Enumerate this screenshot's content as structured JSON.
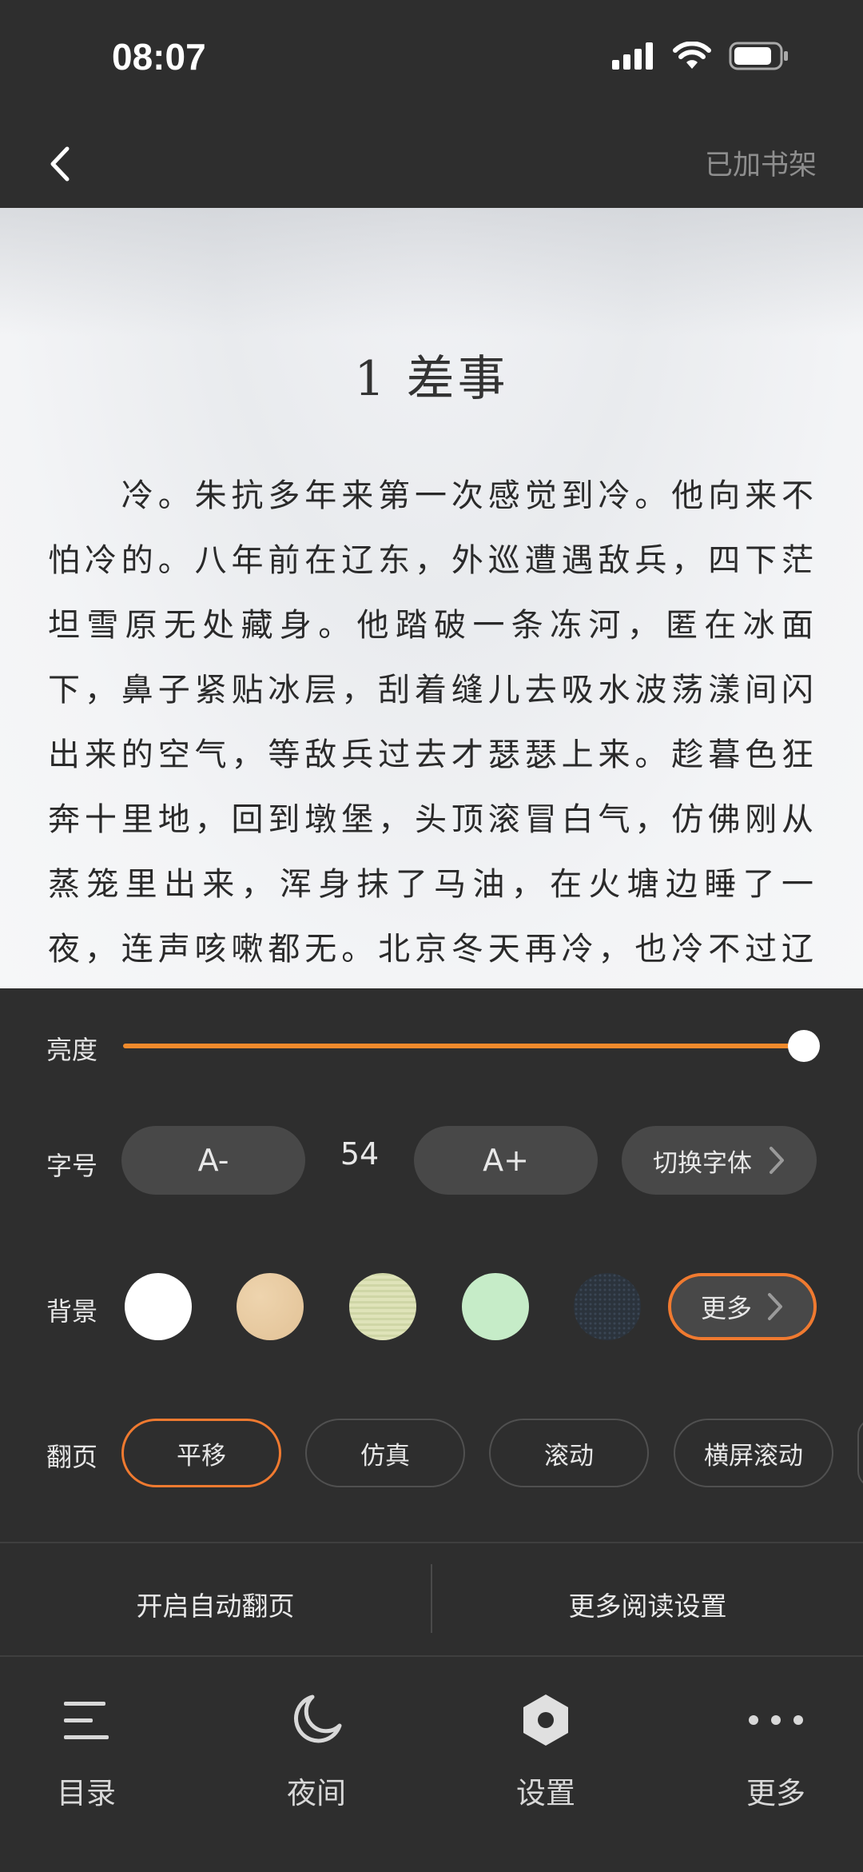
{
  "status_bar": {
    "time": "08:07"
  },
  "top_nav": {
    "shelf_label": "已加书架"
  },
  "chapter": {
    "title": "1 差事",
    "body": "　　冷。朱抗多年来第一次感觉到冷。他向来不怕冷的。八年前在辽东，外巡遭遇敌兵，四下茫坦雪原无处藏身。他踏破一条冻河，匿在冰面下，鼻子紧贴冰层，刮着缝儿去吸水波荡漾间闪出来的空气，等敌兵过去才瑟瑟上来。趁暮色狂奔十里地，回到墩堡，头顶滚冒白气，仿佛刚从蒸笼里出来，浑身抹了马油，在火塘边睡了一夜，连声咳嗽都无。北京冬天再冷，也冷不过辽东。如"
  },
  "settings": {
    "brightness": {
      "label": "亮度",
      "level": 1.0,
      "accent_color": "#f08a2c"
    },
    "font_size": {
      "label": "字号",
      "decrease_label": "A-",
      "value": "54",
      "increase_label": "A+",
      "switch_font_label": "切换字体"
    },
    "background": {
      "label": "背景",
      "swatches": [
        "#ffffff",
        "#e8c9a0",
        "#d8ddb0",
        "#c6ecc8",
        "#2f3944"
      ],
      "more_label": "更多"
    },
    "page_turn": {
      "label": "翻页",
      "options": [
        "平移",
        "仿真",
        "滚动",
        "横屏滚动"
      ],
      "selected": "平移"
    },
    "actions": {
      "auto_flip": "开启自动翻页",
      "more_settings": "更多阅读设置"
    }
  },
  "bottom_nav": {
    "items": [
      {
        "label": "目录",
        "icon": "list-icon"
      },
      {
        "label": "夜间",
        "icon": "moon-icon"
      },
      {
        "label": "设置",
        "icon": "hexagon-settings-icon"
      },
      {
        "label": "更多",
        "icon": "more-dots-icon"
      }
    ]
  }
}
